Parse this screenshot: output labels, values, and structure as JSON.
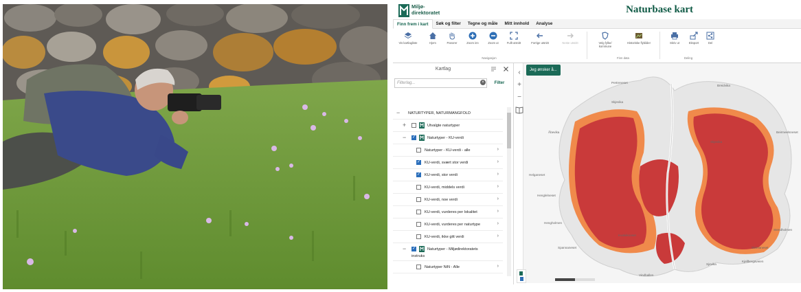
{
  "header": {
    "logo_line1": "Miljø-",
    "logo_line2": "direktoratet",
    "app_title": "Naturbase kart"
  },
  "menu": {
    "tabs": [
      "Finn frem i kart",
      "Søk og filter",
      "Tegne og måle",
      "Mitt innhold",
      "Analyse"
    ],
    "active": "Finn frem i kart"
  },
  "ribbon": {
    "navigation": [
      "Vis kartlagliste",
      "Hjem",
      "Panorer",
      "Zoom inn",
      "Zoom ut",
      "Fullt utsnitt",
      "Forrige utsnitt",
      "Neste utsnitt"
    ],
    "navigation_group": "Navigasjon",
    "map_data": [
      "Velg fylke/ kommune",
      "Historiske flybilder"
    ],
    "map_data_group": "Finn data",
    "share": [
      "Skriv ut",
      "Eksport",
      "Del"
    ],
    "share_group": "Deling"
  },
  "layers_panel": {
    "title": "Kartlag",
    "filter_placeholder": "Filterlag...",
    "filter_button": "Filter",
    "items": [
      {
        "label": "NATURTYPER, NATURMANGFOLD",
        "level": 0,
        "expander": "−",
        "checked": null
      },
      {
        "label": "Utvalgte naturtyper",
        "level": 1,
        "expander": "+",
        "checked": false
      },
      {
        "label": "Naturtyper - KU-verdi",
        "level": 1,
        "expander": "−",
        "checked": true
      },
      {
        "label": "Naturtyper - KU-verdi - alle",
        "level": 2,
        "checked": false
      },
      {
        "label": "KU-verdi, svært stor verdi",
        "level": 2,
        "checked": true
      },
      {
        "label": "KU-verdi, stor verdi",
        "level": 2,
        "checked": true
      },
      {
        "label": "KU-verdi, middels verdi",
        "level": 2,
        "checked": false
      },
      {
        "label": "KU-verdi, noe verdi",
        "level": 2,
        "checked": false
      },
      {
        "label": "KU-verdi, vurderes per lokalitet",
        "level": 2,
        "checked": false
      },
      {
        "label": "KU-verdi, vurderes per naturtype",
        "level": 2,
        "checked": false
      },
      {
        "label": "KU-verdi, ikke gitt verdi",
        "level": 2,
        "checked": false
      },
      {
        "label": "Naturtyper - Miljødirektoratets",
        "label2": "instruks",
        "level": 1,
        "expander": "−",
        "checked": true
      },
      {
        "label": "Naturtyper NiN - Alle",
        "level": 2,
        "checked": false
      }
    ]
  },
  "map": {
    "wish_button": "Jeg ønsker å...",
    "places": [
      "Pertreneset",
      "Breidvika",
      "Skjevika",
      "Åbevika",
      "Beirmeelsneset",
      "Helganeset",
      "Henglelneset",
      "Hengholmen",
      "Spannaneset",
      "Skjevika",
      "Kvalviknoset",
      "Starvaneset",
      "Stendholmen",
      "Vindballen",
      "Kjellbergaveien",
      "Sjevika"
    ],
    "colors": {
      "high_value": "#c93a3a",
      "value": "#f08a4b",
      "land": "#e8e8e8",
      "sea": "#f5f5f5"
    }
  }
}
